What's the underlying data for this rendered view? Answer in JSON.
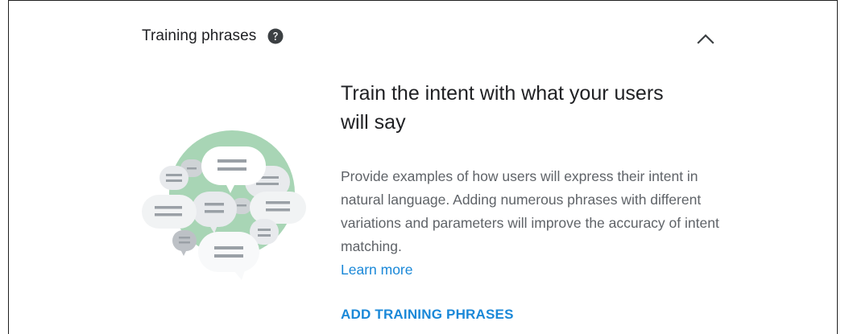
{
  "section": {
    "title": "Training phrases",
    "help_icon": "help-circle-icon",
    "collapse_icon": "chevron-up-icon"
  },
  "empty_state": {
    "headline": "Train the intent with what your users will say",
    "description": "Provide examples of how users will express their intent in natural language. Adding numerous phrases with different variations and parameters will improve the accuracy of intent matching.",
    "learn_more_label": "Learn more",
    "illustration_icon": "chat-bubbles-illustration"
  },
  "actions": {
    "add_label": "ADD TRAINING PHRASES"
  },
  "colors": {
    "accent": "#1a88d8",
    "text_primary": "#202124",
    "text_secondary": "#5f6368",
    "illustration_green": "#a8d5b5",
    "bubble_light": "#f1f3f4",
    "bubble_mid": "#dadce0",
    "bubble_line": "#9aa0a6"
  }
}
